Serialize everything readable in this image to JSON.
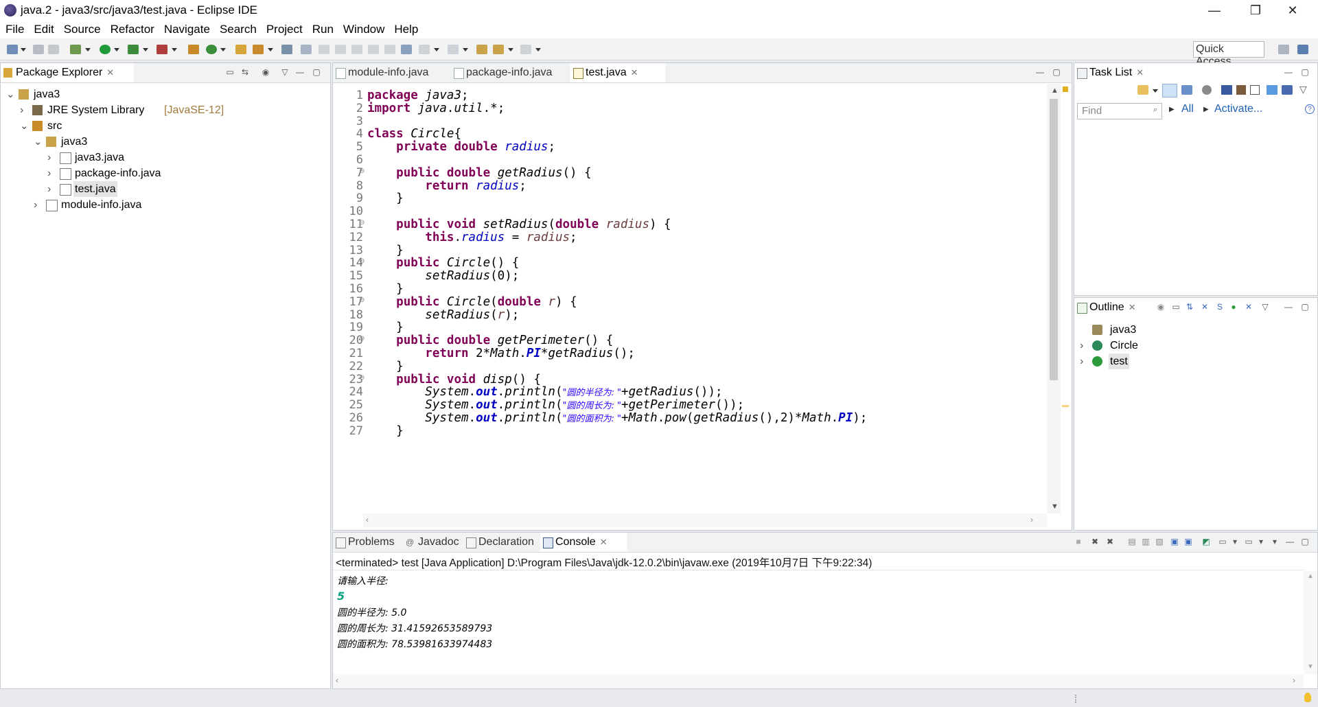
{
  "window": {
    "title": "java.2 - java3/src/java3/test.java - Eclipse IDE",
    "controls": [
      "—",
      "❐",
      "✕"
    ]
  },
  "menu": [
    "File",
    "Edit",
    "Source",
    "Refactor",
    "Navigate",
    "Search",
    "Project",
    "Run",
    "Window",
    "Help"
  ],
  "toolbar": {
    "quick_access": "Quick Access"
  },
  "package_explorer": {
    "title": "Package Explorer",
    "tree": [
      {
        "label": "java3",
        "depth": 0,
        "twisty": "v",
        "icon": "project-icon"
      },
      {
        "label": "JRE System Library",
        "extra": "[JavaSE-12]",
        "depth": 1,
        "twisty": ">",
        "icon": "library-icon"
      },
      {
        "label": "src",
        "depth": 1,
        "twisty": "v",
        "icon": "source-folder-icon"
      },
      {
        "label": "java3",
        "depth": 2,
        "twisty": "v",
        "icon": "package-icon"
      },
      {
        "label": "java3.java",
        "depth": 3,
        "twisty": ">",
        "icon": "java-file-icon"
      },
      {
        "label": "package-info.java",
        "depth": 3,
        "twisty": ">",
        "icon": "java-file-icon"
      },
      {
        "label": "test.java",
        "depth": 3,
        "twisty": ">",
        "icon": "java-file-icon",
        "selected": true
      },
      {
        "label": "module-info.java",
        "depth": 2,
        "twisty": ">",
        "icon": "java-file-icon"
      }
    ]
  },
  "editor": {
    "tabs": [
      {
        "label": "module-info.java",
        "active": false
      },
      {
        "label": "package-info.java",
        "active": false
      },
      {
        "label": "test.java",
        "active": true
      }
    ],
    "line_numbers": [
      "1",
      "2",
      "3",
      "4",
      "5",
      "6",
      "7",
      "8",
      "9",
      "10",
      "11",
      "12",
      "13",
      "14",
      "15",
      "16",
      "17",
      "18",
      "19",
      "20",
      "21",
      "22",
      "23",
      "24",
      "25",
      "26",
      "27"
    ],
    "fold_markers": [
      "7",
      "11",
      "14",
      "17",
      "20",
      "23"
    ],
    "lines": [
      "package java3;",
      "import java.util.*;",
      "",
      "class Circle{",
      "    private double radius;",
      "",
      "    public double getRadius() {",
      "        return radius;",
      "    }",
      "",
      "    public void setRadius(double radius) {",
      "        this.radius = radius;",
      "    }",
      "    public Circle() {",
      "        setRadius(0);",
      "    }",
      "    public Circle(double r) {",
      "        setRadius(r);",
      "    }",
      "    public double getPerimeter() {",
      "        return 2*Math.PI*getRadius();",
      "    }",
      "    public void disp() {",
      "        System.out.println(\"圆的半径为: \"+getRadius());",
      "        System.out.println(\"圆的周长为: \"+getPerimeter());",
      "        System.out.println(\"圆的面积为: \"+Math.pow(getRadius(),2)*Math.PI);",
      "    }"
    ]
  },
  "task_list": {
    "title": "Task List",
    "find_placeholder": "Find",
    "all_label": "All",
    "activate_label": "Activate..."
  },
  "outline": {
    "title": "Outline",
    "items": [
      {
        "label": "java3",
        "icon": "package-decl-icon"
      },
      {
        "label": "Circle",
        "icon": "class-icon"
      },
      {
        "label": "test",
        "icon": "public-class-icon",
        "selected": true
      }
    ]
  },
  "bottom": {
    "tabs": [
      {
        "label": "Problems",
        "active": false
      },
      {
        "label": "Javadoc",
        "active": false
      },
      {
        "label": "Declaration",
        "active": false
      },
      {
        "label": "Console",
        "active": true
      }
    ],
    "terminated": "<terminated> test [Java Application] D:\\Program Files\\Java\\jdk-12.0.2\\bin\\javaw.exe (2019年10月7日 下午9:22:34)",
    "console_lines": [
      {
        "text": "请输入半径:",
        "color": "#000000"
      },
      {
        "text": "5",
        "color": "#00a080"
      },
      {
        "text": "圆的半径为: 5.0",
        "color": "#000000"
      },
      {
        "text": "圆的周长为: 31.41592653589793",
        "color": "#000000"
      },
      {
        "text": "圆的面积为: 78.53981633974483",
        "color": "#000000"
      }
    ]
  },
  "colors": {
    "keyword": "#7f0055",
    "field": "#0000c0",
    "string": "#2a00ff",
    "selection": "#e4e4e4"
  }
}
